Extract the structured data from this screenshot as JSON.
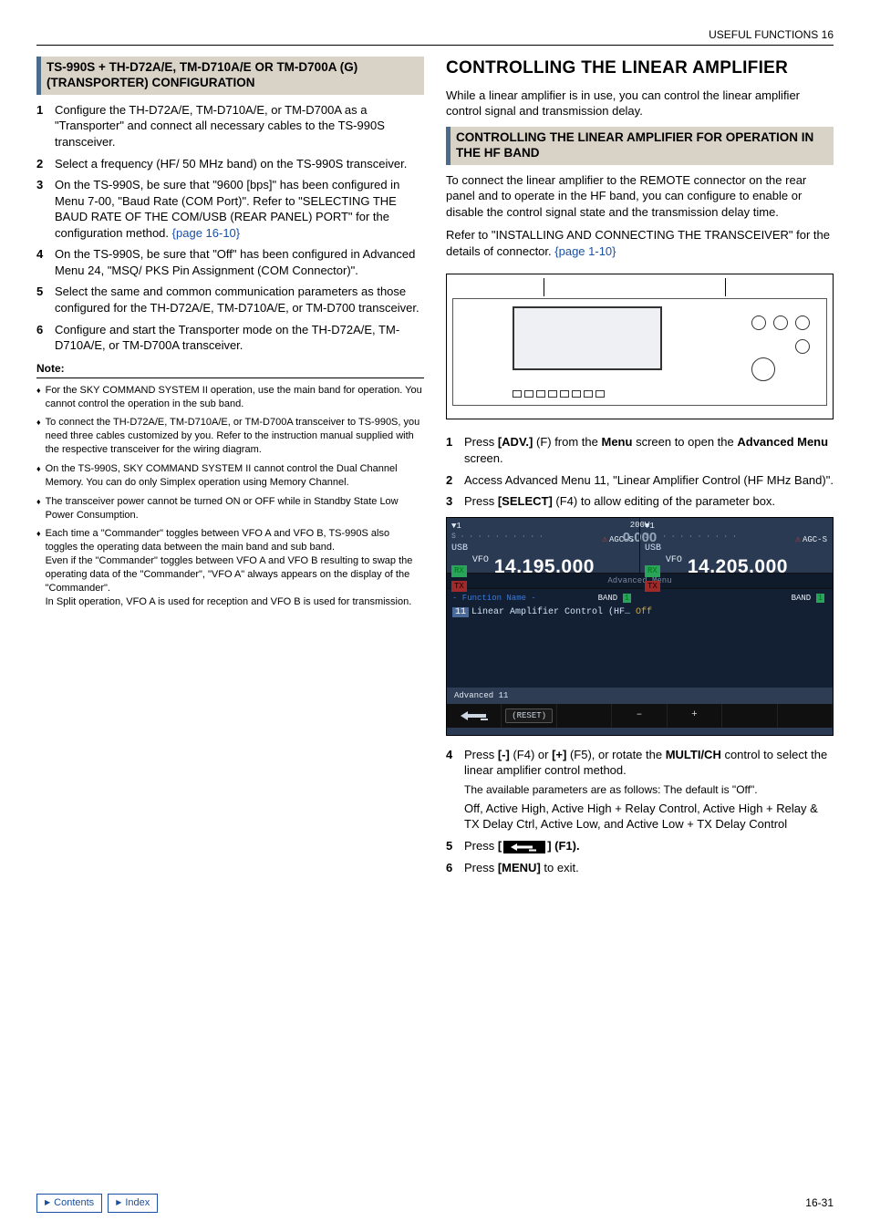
{
  "header": {
    "chapter": "USEFUL FUNCTIONS 16"
  },
  "left": {
    "section_title": "TS-990S + TH-D72A/E, TM-D710A/E OR TM-D700A (G) (TRANSPORTER) CONFIGURATION",
    "steps": [
      "Configure the TH-D72A/E, TM-D710A/E, or TM-D700A as a \"Transporter\" and connect all necessary cables to the TS-990S transceiver.",
      "Select a frequency (HF/ 50 MHz band) on the TS-990S transceiver.",
      "On the TS-990S, be sure that \"9600 [bps]\" has been configured in Menu 7-00, \"Baud Rate (COM Port)\". Refer to \"SELECTING THE BAUD RATE OF THE COM/USB (REAR PANEL) PORT\" for the configuration method.",
      "On the TS-990S, be sure that \"Off\" has been configured in Advanced Menu 24, \"MSQ/ PKS Pin Assignment (COM Connector)\".",
      "Select the same and common communication parameters as those configured for the TH-D72A/E, TM-D710A/E, or TM-D700 transceiver.",
      "Configure and start the Transporter mode on the TH-D72A/E, TM-D710A/E, or TM-D700A transceiver."
    ],
    "step3_link": "{page 16-10}",
    "note_label": "Note:",
    "notes": [
      "For the SKY COMMAND SYSTEM II operation, use the main band for operation. You cannot control the operation in the sub band.",
      "To connect the TH-D72A/E, TM-D710A/E, or TM-D700A transceiver to TS-990S, you need three cables customized by you. Refer to the instruction manual supplied with the respective transceiver for the wiring diagram.",
      "On the TS-990S, SKY COMMAND SYSTEM II cannot control the Dual Channel Memory. You can do only Simplex operation using Memory Channel.",
      "The transceiver power cannot be turned ON or OFF while in Standby State Low Power Consumption.",
      "Each time a \"Commander\" toggles between VFO A and VFO B, TS-990S also toggles the operating data between the main band and sub band.\nEven if the \"Commander\" toggles between VFO A and VFO B resulting to swap the operating data of the \"Commander\", \"VFO A\" always appears on the display of the \"Commander\".\nIn Split operation, VFO A is used for reception and VFO B is used for transmission."
    ]
  },
  "right": {
    "h1": "CONTROLLING THE LINEAR AMPLIFIER",
    "intro": "While a linear amplifier is in use, you can control the linear amplifier control signal and transmission delay.",
    "section_title": "CONTROLLING THE LINEAR AMPLIFIER FOR OPERATION IN THE HF BAND",
    "para1": "To connect the linear amplifier to the REMOTE connector on the rear panel and to operate in the HF band, you can configure to enable or disable the control signal state and the transmission delay time.",
    "para2a": "Refer to \"INSTALLING AND CONNECTING THE TRANSCEIVER\" for the details of connector.",
    "para2_link": "{page 1-10}",
    "steps_a": [
      {
        "pre": "Press ",
        "b1": "[ADV.]",
        "mid": " (F) from the ",
        "b2": "Menu",
        "post": " screen to open the ",
        "b3": "Advanced Menu",
        "post2": " screen."
      },
      {
        "text": "Access Advanced Menu 11, \"Linear Amplifier Control (HF MHz Band)\"."
      },
      {
        "pre": "Press ",
        "b1": "[SELECT]",
        "post": " (F4) to allow editing of the parameter box."
      }
    ],
    "screenshot": {
      "ant": "1",
      "usb": "USB",
      "rx": "RX",
      "tx": "TX",
      "vfo": "VFO",
      "freq_main": "14.195.000",
      "freq_sub": "14.205.000",
      "agc": "AGC-S",
      "band_main": "BAND",
      "band_main_n": "1",
      "band_sub_n": "1",
      "pw": "200W",
      "zeros": "0.000",
      "menu_title": "Advanced Menu",
      "fn_label": "- Function Name -",
      "row_idx": "11",
      "row_label": "Linear Amplifier Control (HF…",
      "row_val": "Off",
      "status": "Advanced 11",
      "btn_reset": "(RESET)",
      "btn_minus": "–",
      "btn_plus": "+"
    },
    "step4": {
      "pre": "Press ",
      "b1": "[-]",
      "mid1": " (F4) or ",
      "b2": "[+]",
      "mid2": " (F5), or rotate the ",
      "b3": "MULTI/CH",
      "post": " control to select the linear amplifier control method."
    },
    "step4_sub1": "The available parameters are as follows: The default is \"Off\".",
    "step4_sub2": "Off, Active High, Active High + Relay Control, Active High + Relay & TX Delay Ctrl, Active Low, and Active Low + TX Delay Control",
    "step5_pre": "Press ",
    "step5_b": "[",
    "step5_post": "] (F1).",
    "step6_pre": "Press ",
    "step6_b": "[MENU]",
    "step6_post": " to exit."
  },
  "footer": {
    "contents": "Contents",
    "index": "Index",
    "page": "16-31"
  }
}
